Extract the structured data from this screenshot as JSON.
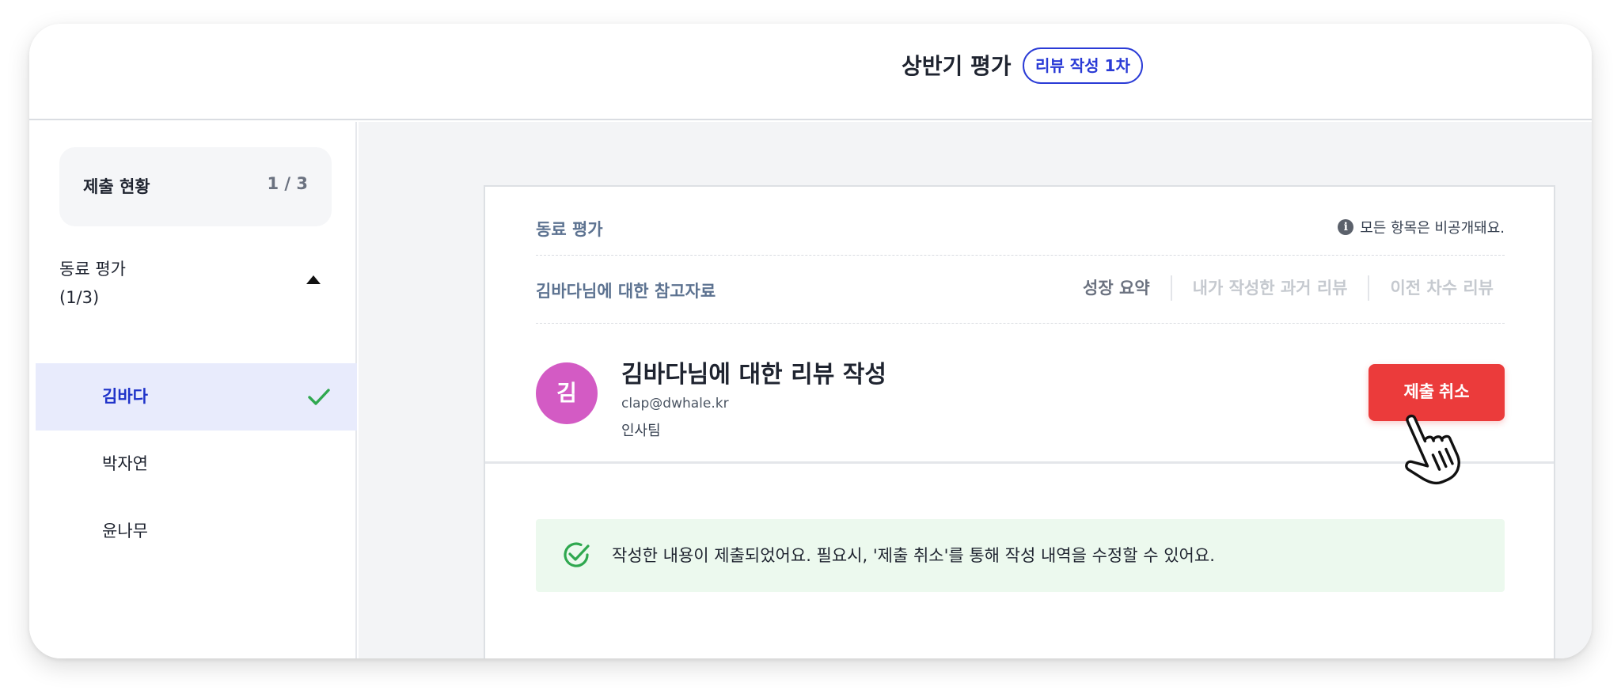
{
  "header": {
    "title": "상반기 평가",
    "badge": "리뷰 작성 1차"
  },
  "sidebar": {
    "status_label": "제출 현황",
    "status_count": "1 / 3",
    "group_title": "동료 평가",
    "group_count": "(1/3)",
    "members": [
      {
        "name": "김바다",
        "completed": true
      },
      {
        "name": "박자연",
        "completed": false
      },
      {
        "name": "윤나무",
        "completed": false
      }
    ]
  },
  "main": {
    "section_label": "동료 평가",
    "notice": "모든 항목은 비공개돼요.",
    "reference_label": "김바다님에 대한 참고자료",
    "reference_tabs": [
      "성장 요약",
      "내가 작성한 과거 리뷰",
      "이전 차수 리뷰"
    ],
    "avatar_initial": "김",
    "avatar_color": "#d35bc4",
    "review_title": "김바다님에 대한 리뷰 작성",
    "email": "clap@dwhale.kr",
    "team": "인사팀",
    "cancel_button": "제출 취소",
    "success_message": "작성한 내용이 제출되었어요. 필요시, '제출 취소'를 통해 작성 내역을 수정할 수 있어요."
  },
  "colors": {
    "accent": "#2a3bd6",
    "danger": "#eb3b3b",
    "success": "#2fa84f",
    "selected_bg": "#e8ebfc"
  }
}
